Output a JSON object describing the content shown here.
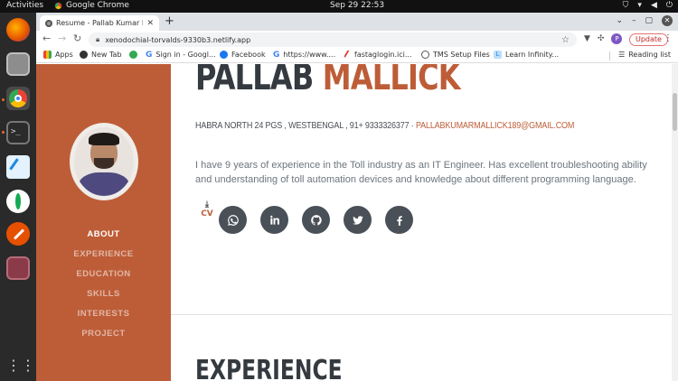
{
  "system": {
    "activities": "Activities",
    "app_name": "Google Chrome",
    "clock": "Sep 29  22:53"
  },
  "browser": {
    "tab_title": "Resume - Pallab Kumar M",
    "url": "xenodochial-torvalds-9330b3.netlify.app",
    "update_label": "Update",
    "profile_initial": "P",
    "bookmarks": [
      {
        "label": "Apps",
        "color": "#4285f4"
      },
      {
        "label": "New Tab",
        "color": "#333333"
      },
      {
        "label": "",
        "color": "#34a853"
      },
      {
        "label": "Sign in - Googl...",
        "color": "#4285f4"
      },
      {
        "label": "Facebook",
        "color": "#1877f2"
      },
      {
        "label": "https://www....",
        "color": "#4285f4"
      },
      {
        "label": "fastaglogin.ici...",
        "color": "#e53935"
      },
      {
        "label": "TMS Setup Files",
        "color": "#333333"
      },
      {
        "label": "Learn Infinity...",
        "color": "#1e88e5"
      }
    ],
    "reading_list": "Reading list"
  },
  "sidebar": {
    "nav": [
      {
        "label": "ABOUT",
        "active": true
      },
      {
        "label": "EXPERIENCE",
        "active": false
      },
      {
        "label": "EDUCATION",
        "active": false
      },
      {
        "label": "SKILLS",
        "active": false
      },
      {
        "label": "INTERESTS",
        "active": false
      },
      {
        "label": "PROJECT",
        "active": false
      }
    ],
    "accent": "#bd5d38"
  },
  "about": {
    "first_name": "PALLAB",
    "last_name": "MALLICK",
    "address": "HABRA  NORTH 24 PGS , WESTBENGAL  , 91+ 9333326377 · ",
    "email": "PALLABKUMARMALLICK189@GMAIL.COM",
    "bio": "I have 9 years of experience in the Toll industry as an IT Engineer. Has excellent troubleshooting ability and understanding of toll automation devices and knowledge about different programming language.",
    "cv_label": "CV",
    "social_icons": [
      "whatsapp-icon",
      "linkedin-icon",
      "github-icon",
      "twitter-icon",
      "facebook-icon"
    ]
  },
  "experience": {
    "title": "EXPERIENCE"
  }
}
